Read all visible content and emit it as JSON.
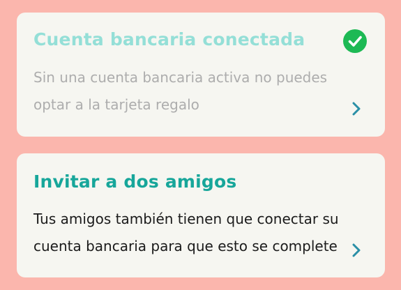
{
  "cards": [
    {
      "title": "Cuenta bancaria conectada",
      "description": "Sin una cuenta bancaria activa no puedes optar a la tarjeta regalo",
      "status_icon": "check-circle-icon",
      "chevron_icon": "chevron-right-icon",
      "completed": true
    },
    {
      "title": "Invitar a dos amigos",
      "description": "Tus amigos también tienen que conectar su cuenta bancaria para que esto se complete",
      "chevron_icon": "chevron-right-icon",
      "completed": false
    }
  ],
  "colors": {
    "background": "#fbb6ad",
    "card": "#f6f6f1",
    "title_done": "#94dfd7",
    "title_pending": "#17a69a",
    "check": "#1db954",
    "chevron": "#2a8fa6",
    "text_muted": "#adadad",
    "text_dark": "#1b1b1b"
  }
}
